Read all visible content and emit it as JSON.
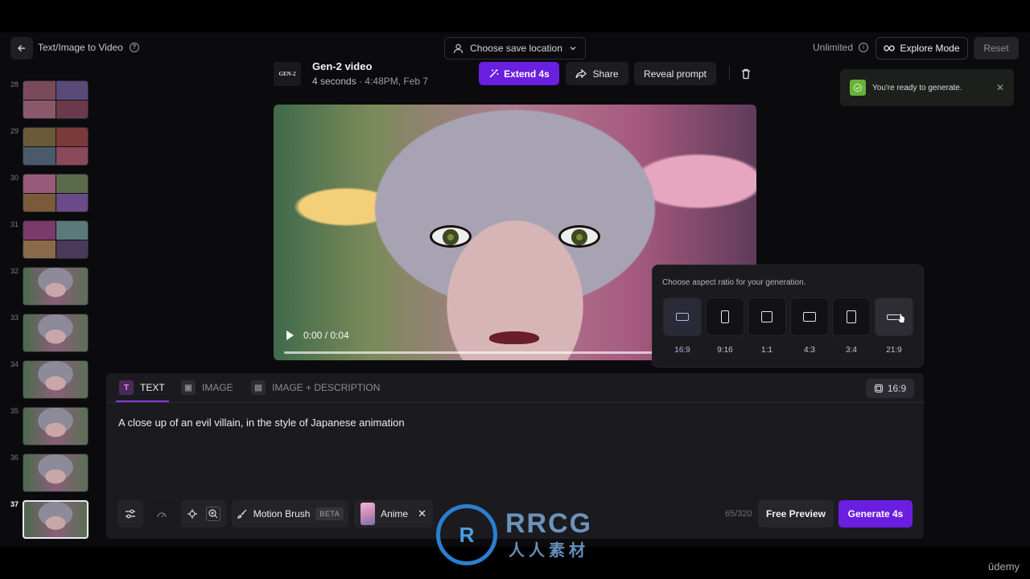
{
  "header": {
    "title": "Text/Image to Video",
    "save_location": "Choose save location",
    "plan": "Unlimited",
    "explore_mode": "Explore Mode",
    "reset": "Reset"
  },
  "sidebar": {
    "thumbnails": [
      {
        "num": "28",
        "kind": "grid"
      },
      {
        "num": "29",
        "kind": "grid"
      },
      {
        "num": "30",
        "kind": "grid"
      },
      {
        "num": "31",
        "kind": "grid"
      },
      {
        "num": "32",
        "kind": "face"
      },
      {
        "num": "33",
        "kind": "face"
      },
      {
        "num": "34",
        "kind": "face"
      },
      {
        "num": "35",
        "kind": "face"
      },
      {
        "num": "36",
        "kind": "face"
      },
      {
        "num": "37",
        "kind": "face",
        "active": true
      }
    ]
  },
  "video": {
    "logo_text": "GEN-2",
    "title": "Gen-2 video",
    "duration": "4 seconds",
    "timestamp": "4:48PM, Feb 7",
    "extend_label": "Extend 4s",
    "share_label": "Share",
    "reveal_label": "Reveal prompt",
    "player_time": "0:00 / 0:04"
  },
  "toast": {
    "message": "You're ready to generate."
  },
  "aspect_popover": {
    "title": "Choose aspect ratio for your generation.",
    "options": [
      "16:9",
      "9:16",
      "1:1",
      "4:3",
      "3:4",
      "21:9"
    ],
    "selected": "16:9"
  },
  "prompt_panel": {
    "tabs": [
      "TEXT",
      "IMAGE",
      "IMAGE + DESCRIPTION"
    ],
    "active_tab": "TEXT",
    "ratio": "16:9",
    "prompt": "A close up of an evil villain, in the style of Japanese animation",
    "motion_brush": "Motion Brush",
    "beta": "BETA",
    "style": "Anime",
    "char_count": "65/320",
    "free_preview": "Free Preview",
    "generate": "Generate 4s"
  },
  "watermark": {
    "logo": "R",
    "brand": "RRCG",
    "sub": "人人素材",
    "udemy": "ūdemy"
  },
  "colors": {
    "accent": "#6a1ee0",
    "background": "#0b0b0d",
    "toast_check": "#67b238"
  }
}
